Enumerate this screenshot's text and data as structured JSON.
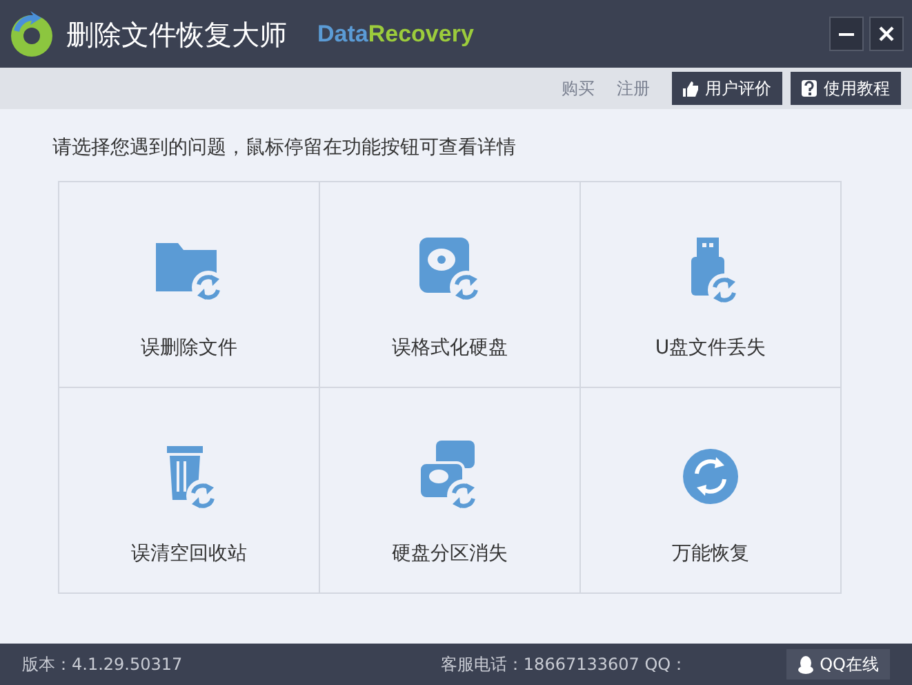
{
  "window": {
    "title": "删除文件恢复大师",
    "brand_part_1": "Data",
    "brand_part_2": "Recovery"
  },
  "toolbar": {
    "links": [
      "购买",
      "注册"
    ],
    "buttons": [
      "用户评价",
      "使用教程"
    ]
  },
  "prompt": "请选择您遇到的问题，鼠标停留在功能按钮可查看详情",
  "options": [
    {
      "label": "误删除文件"
    },
    {
      "label": "误格式化硬盘"
    },
    {
      "label": "U盘文件丢失"
    },
    {
      "label": "误清空回收站"
    },
    {
      "label": "硬盘分区消失"
    },
    {
      "label": "万能恢复"
    }
  ],
  "status_bar": {
    "version": "版本：4.1.29.50317",
    "hotline": "客服电话：18667133607 QQ：",
    "qq_button": "QQ在线"
  }
}
